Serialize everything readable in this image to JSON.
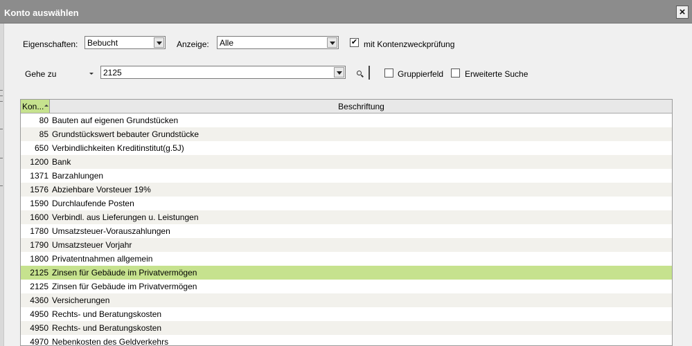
{
  "window": {
    "title": "Konto auswählen",
    "close_label": "×"
  },
  "filters": {
    "eigenschaften_label": "Eigenschaften:",
    "eigenschaften_value": "Bebucht",
    "anzeige_label": "Anzeige:",
    "anzeige_value": "Alle",
    "kontenzweck_label": "mit Kontenzweckprüfung",
    "kontenzweck_checked": true,
    "kontenzweck_mark": "✔"
  },
  "goto": {
    "label": "Gehe zu",
    "value": "2125",
    "gruppierfeld_label": "Gruppierfeld",
    "gruppierfeld_checked": false,
    "erweiterte_label": "Erweiterte Suche",
    "erweiterte_checked": false
  },
  "table": {
    "col_konto": "Kon...",
    "col_beschriftung": "Beschriftung",
    "sort_column": "Konto",
    "sort_direction": "ascending",
    "selected_index": 11,
    "highlight_color": "#c6e28e",
    "rows": [
      {
        "num": "80",
        "text": "Bauten auf eigenen Grundstücken"
      },
      {
        "num": "85",
        "text": "Grundstückswert bebauter Grundstücke"
      },
      {
        "num": "650",
        "text": "Verbindlichkeiten Kreditinstitut(g.5J)"
      },
      {
        "num": "1200",
        "text": "Bank"
      },
      {
        "num": "1371",
        "text": "Barzahlungen"
      },
      {
        "num": "1576",
        "text": "Abziehbare Vorsteuer 19%"
      },
      {
        "num": "1590",
        "text": "Durchlaufende Posten"
      },
      {
        "num": "1600",
        "text": "Verbindl. aus Lieferungen u. Leistungen"
      },
      {
        "num": "1780",
        "text": "Umsatzsteuer-Vorauszahlungen"
      },
      {
        "num": "1790",
        "text": "Umsatzsteuer Vorjahr"
      },
      {
        "num": "1800",
        "text": "Privatentnahmen allgemein"
      },
      {
        "num": "2125",
        "text": "Zinsen für Gebäude im Privatvermögen"
      },
      {
        "num": "2125",
        "text": "Zinsen für Gebäude im Privatvermögen"
      },
      {
        "num": "4360",
        "text": "Versicherungen"
      },
      {
        "num": "4950",
        "text": "Rechts- und Beratungskosten"
      },
      {
        "num": "4950",
        "text": "Rechts- und Beratungskosten"
      },
      {
        "num": "4970",
        "text": "Nebenkosten des Geldverkehrs"
      }
    ]
  }
}
